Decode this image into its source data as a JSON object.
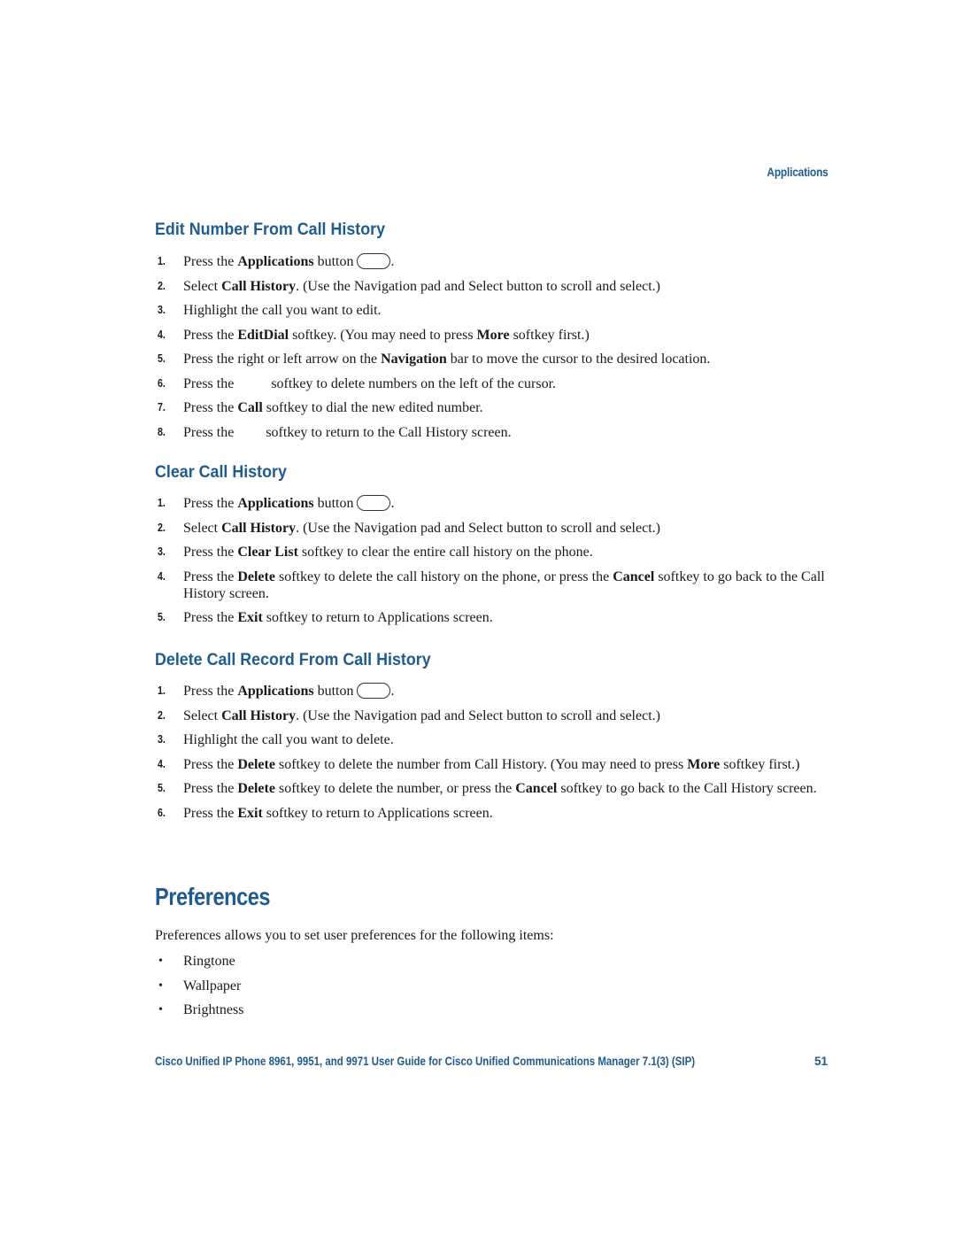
{
  "running_head": "Applications",
  "sections": [
    {
      "heading": "Edit Number From Call History",
      "steps": [
        {
          "num": "1.",
          "parts": [
            "Press the ",
            "Applications",
            " button",
            "."
          ]
        },
        {
          "num": "2.",
          "parts": [
            "Select ",
            "Call History",
            ". (Use the Navigation pad and Select button to scroll and select.)"
          ]
        },
        {
          "num": "3.",
          "text": "Highlight the call you want to edit."
        },
        {
          "num": "4.",
          "parts": [
            "Press the ",
            "EditDial",
            " softkey. (You may need to press ",
            "More",
            " softkey first.)"
          ]
        },
        {
          "num": "5.",
          "parts": [
            "Press the right or left arrow on the ",
            "Navigation",
            " bar to move the cursor to the desired location."
          ]
        },
        {
          "num": "6.",
          "parts": [
            "Press the ",
            "softkey to delete numbers on the left of the cursor."
          ]
        },
        {
          "num": "7.",
          "parts": [
            "Press the ",
            "Call",
            " softkey to dial the new edited number."
          ]
        },
        {
          "num": "8.",
          "parts": [
            "Press the ",
            "softkey to return to the Call History screen."
          ]
        }
      ]
    },
    {
      "heading": "Clear Call History",
      "steps": [
        {
          "num": "1.",
          "parts": [
            "Press the ",
            "Applications",
            " button",
            "."
          ]
        },
        {
          "num": "2.",
          "parts": [
            "Select ",
            "Call History",
            ". (Use the Navigation pad and Select button to scroll and select.)"
          ]
        },
        {
          "num": "3.",
          "parts": [
            "Press the ",
            "Clear List",
            " softkey to clear the entire call history on the phone."
          ]
        },
        {
          "num": "4.",
          "parts": [
            "Press the ",
            "Delete",
            " softkey to delete the call history on the phone, or press the ",
            "Cancel",
            " softkey to go back to the Call History screen."
          ]
        },
        {
          "num": "5.",
          "parts": [
            "Press the ",
            "Exit",
            " softkey to return to Applications screen."
          ]
        }
      ]
    },
    {
      "heading": "Delete Call Record From Call History",
      "steps": [
        {
          "num": "1.",
          "parts": [
            "Press the ",
            "Applications",
            " button",
            "."
          ]
        },
        {
          "num": "2.",
          "parts": [
            "Select ",
            "Call History",
            ". (Use the Navigation pad and Select button to scroll and select.)"
          ]
        },
        {
          "num": "3.",
          "text": "Highlight the call you want to delete."
        },
        {
          "num": "4.",
          "parts": [
            "Press the ",
            "Delete",
            " softkey to delete the number from Call History. (You may need to press ",
            "More",
            " softkey first.)"
          ]
        },
        {
          "num": "5.",
          "parts": [
            "Press the ",
            "Delete",
            " softkey to delete the number, or press the ",
            "Cancel",
            " softkey to go back to the Call History screen."
          ]
        },
        {
          "num": "6.",
          "parts": [
            "Press the ",
            "Exit",
            " softkey to return to Applications screen."
          ]
        }
      ]
    }
  ],
  "preferences": {
    "heading": "Preferences",
    "intro": "Preferences allows you to set user preferences for the following items:",
    "items": [
      "Ringtone",
      "Wallpaper",
      "Brightness"
    ]
  },
  "footer": {
    "title": "Cisco Unified IP Phone 8961, 9951, and 9971 User Guide for Cisco Unified Communications Manager 7.1(3) (SIP)",
    "page_number": "51"
  },
  "icons": {
    "applications_button": "applications-button-icon",
    "bullet": "•"
  },
  "colors": {
    "heading": "#1f5b8c",
    "body_text": "#1a1a1a"
  }
}
